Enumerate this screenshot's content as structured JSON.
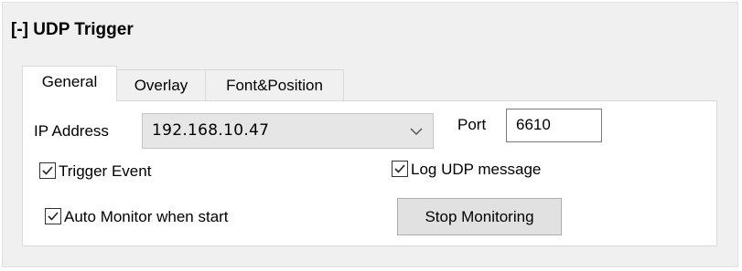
{
  "panel": {
    "title": "[-] UDP Trigger"
  },
  "tabs": [
    {
      "label": "General",
      "active": true
    },
    {
      "label": "Overlay",
      "active": false
    },
    {
      "label": "Font&Position",
      "active": false
    }
  ],
  "general": {
    "ip_label": "IP Address",
    "ip_value": "192.168.10.47",
    "port_label": "Port",
    "port_value": "6610",
    "trigger_event": {
      "label": "Trigger Event",
      "checked": true
    },
    "log_udp": {
      "label": "Log UDP message",
      "checked": true
    },
    "auto_monitor": {
      "label": "Auto Monitor when start",
      "checked": true
    },
    "stop_button": "Stop Monitoring"
  },
  "icons": {
    "combo_arrow": "chevron-down-icon",
    "check": "checkmark-icon"
  }
}
